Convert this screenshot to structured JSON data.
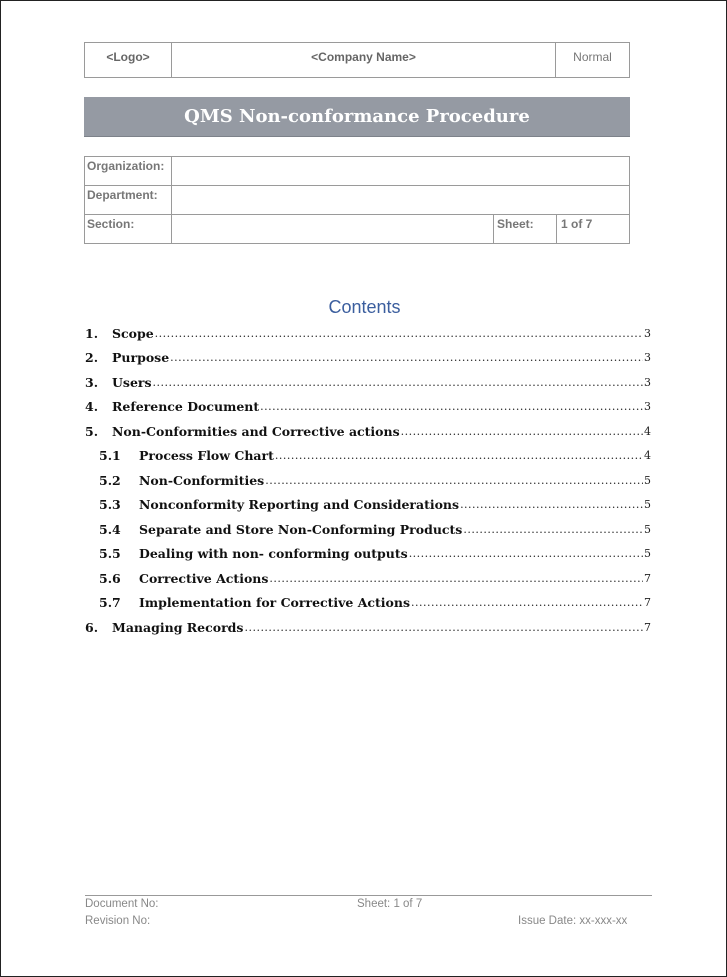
{
  "header": {
    "logo": "<Logo>",
    "company_name": "<Company Name>",
    "classification": "Normal"
  },
  "title": "QMS Non-conformance Procedure",
  "info_table": {
    "organization_label": "Organization:",
    "organization_value": "",
    "department_label": "Department:",
    "department_value": "",
    "section_label": "Section:",
    "section_value": "",
    "sheet_label": "Sheet:",
    "sheet_value": "1 of 7"
  },
  "contents": {
    "heading": "Contents",
    "entries": [
      {
        "number": "1.",
        "label": "Scope",
        "page": "3",
        "level": 1
      },
      {
        "number": "2.",
        "label": "Purpose",
        "page": "3",
        "level": 1
      },
      {
        "number": "3.",
        "label": "Users",
        "page": "3",
        "level": 1
      },
      {
        "number": "4.",
        "label": "Reference Document",
        "page": "3",
        "level": 1
      },
      {
        "number": "5.",
        "label": "Non-Conformities and Corrective actions",
        "page": "4",
        "level": 1
      },
      {
        "number": "5.1",
        "label": "Process Flow Chart",
        "page": "4",
        "level": 2
      },
      {
        "number": "5.2",
        "label": "Non-Conformities",
        "page": "5",
        "level": 2
      },
      {
        "number": "5.3",
        "label": "Nonconformity Reporting and Considerations",
        "page": "5",
        "level": 2
      },
      {
        "number": "5.4",
        "label": "Separate and Store Non-Conforming Products",
        "page": "5",
        "level": 2
      },
      {
        "number": "5.5",
        "label": "Dealing with non- conforming outputs",
        "page": "5",
        "level": 2
      },
      {
        "number": "5.6",
        "label": "Corrective Actions",
        "page": "7",
        "level": 2
      },
      {
        "number": "5.7",
        "label": "Implementation for Corrective Actions",
        "page": "7",
        "level": 2
      },
      {
        "number": "6.",
        "label": "Managing Records",
        "page": "7",
        "level": 1
      }
    ]
  },
  "footer": {
    "document_no": "Document No:",
    "revision_no": "Revision No:",
    "sheet": "Sheet: 1 of 7",
    "issue_date": "Issue Date: xx-xxx-xx"
  }
}
